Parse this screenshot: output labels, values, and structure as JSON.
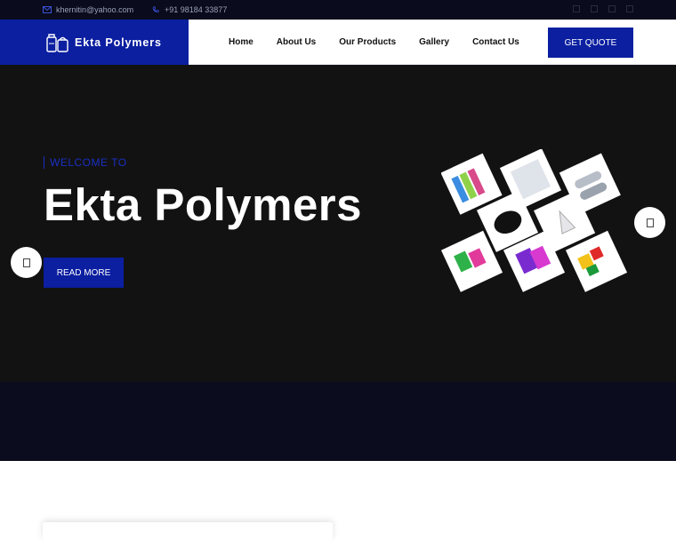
{
  "topbar": {
    "email": "khernitin@yahoo.com",
    "phone": "+91 98184 33877",
    "socials": [
      "facebook-icon",
      "twitter-icon",
      "linkedin-icon",
      "instagram-icon"
    ]
  },
  "header": {
    "logo_text": "Ekta Polymers",
    "nav": [
      "Home",
      "About Us",
      "Our Products",
      "Gallery",
      "Contact Us"
    ],
    "cta": "GET QUOTE"
  },
  "hero": {
    "kicker": "WELCOME TO",
    "title": "Ekta Polymers",
    "button": "READ MORE"
  },
  "colors": {
    "brand": "#0b1fa0",
    "hero_bg": "#121212",
    "dark_band": "#0b0c1e"
  }
}
